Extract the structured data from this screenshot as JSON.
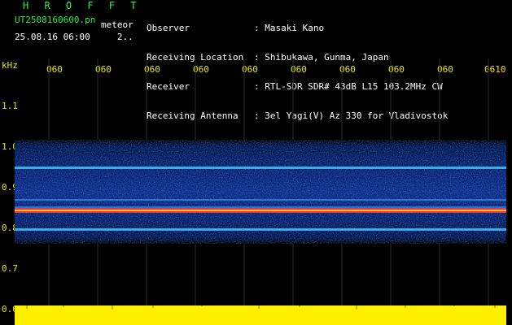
{
  "header": {
    "brand": "H R O F F T",
    "file": "UT2508160600.pn",
    "mode": "meteor",
    "datetime": "25.08.16 06:00     2..",
    "fields": [
      {
        "label": "Observer",
        "value": ": Masaki Kano"
      },
      {
        "label": "Receiving Location",
        "value": ": Shibukawa, Gunma, Japan"
      },
      {
        "label": "Receiver",
        "value": ": RTL-SDR SDR# 43dB L15 103.2MHz CW"
      },
      {
        "label": "Receiving Antenna",
        "value": ": 3el Yagi(V) Az 330 for Vladivostok"
      }
    ]
  },
  "axes": {
    "y_unit": "kHz",
    "y_ticks": [
      "1.1",
      "1.0",
      "0.9",
      "0.8",
      "0.7",
      "0.6"
    ],
    "x_ticks": [
      "060",
      "060",
      "060",
      "060",
      "060",
      "060",
      "060",
      "060",
      "060",
      "0610"
    ]
  },
  "colors": {
    "axis": "#e8e800",
    "header_green": "#22ee55",
    "header_white": "#ffffff",
    "spectrum_bg": "#001a66",
    "trace": "#ff3355"
  }
}
